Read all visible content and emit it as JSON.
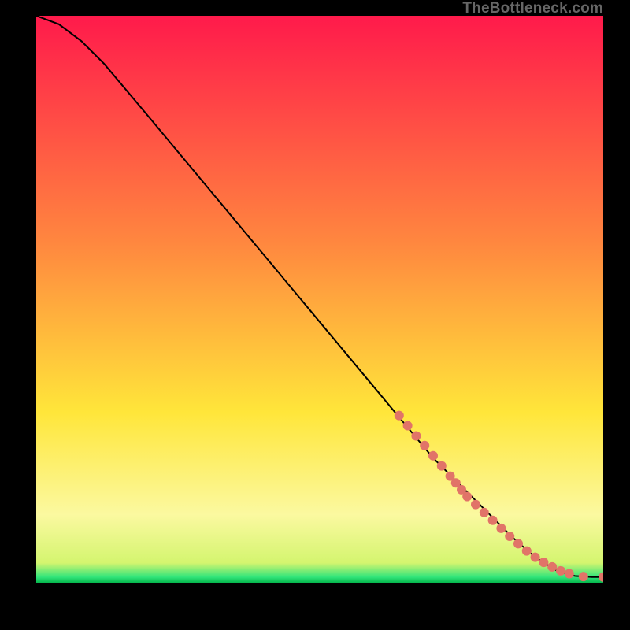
{
  "attribution": "TheBottleneck.com",
  "chart_data": {
    "type": "line",
    "title": "",
    "xlabel": "",
    "ylabel": "",
    "xlim": [
      0,
      100
    ],
    "ylim": [
      0,
      100
    ],
    "background_gradient": [
      {
        "stop": 0.0,
        "color": "#ff1a4b"
      },
      {
        "stop": 0.4,
        "color": "#ff873f"
      },
      {
        "stop": 0.7,
        "color": "#ffe63a"
      },
      {
        "stop": 0.88,
        "color": "#fbf9a0"
      },
      {
        "stop": 0.965,
        "color": "#d4f56f"
      },
      {
        "stop": 0.99,
        "color": "#32e57a"
      },
      {
        "stop": 1.0,
        "color": "#05b74d"
      }
    ],
    "series": [
      {
        "name": "curve",
        "type": "line",
        "color": "#000000",
        "x": [
          0,
          4,
          8,
          12,
          20,
          30,
          40,
          50,
          60,
          70,
          76,
          80,
          84,
          88,
          92,
          95,
          98,
          100
        ],
        "y": [
          100,
          98.5,
          95.5,
          91.5,
          82,
          70,
          58,
          46,
          34,
          22,
          16,
          12,
          8,
          4.5,
          2,
          1.2,
          1.0,
          1.0
        ]
      },
      {
        "name": "markers",
        "type": "scatter",
        "color": "#e17468",
        "x": [
          64,
          65.5,
          67,
          68.5,
          70,
          71.5,
          73,
          74,
          75,
          76,
          77.5,
          79,
          80.5,
          82,
          83.5,
          85,
          86.5,
          88,
          89.5,
          91,
          92.5,
          94,
          96.5,
          100
        ],
        "y": [
          29.5,
          27.7,
          25.9,
          24.2,
          22.4,
          20.6,
          18.8,
          17.6,
          16.4,
          15.2,
          13.8,
          12.4,
          11.0,
          9.6,
          8.2,
          6.9,
          5.6,
          4.5,
          3.6,
          2.8,
          2.1,
          1.6,
          1.1,
          1.0
        ],
        "r": 6
      }
    ]
  }
}
